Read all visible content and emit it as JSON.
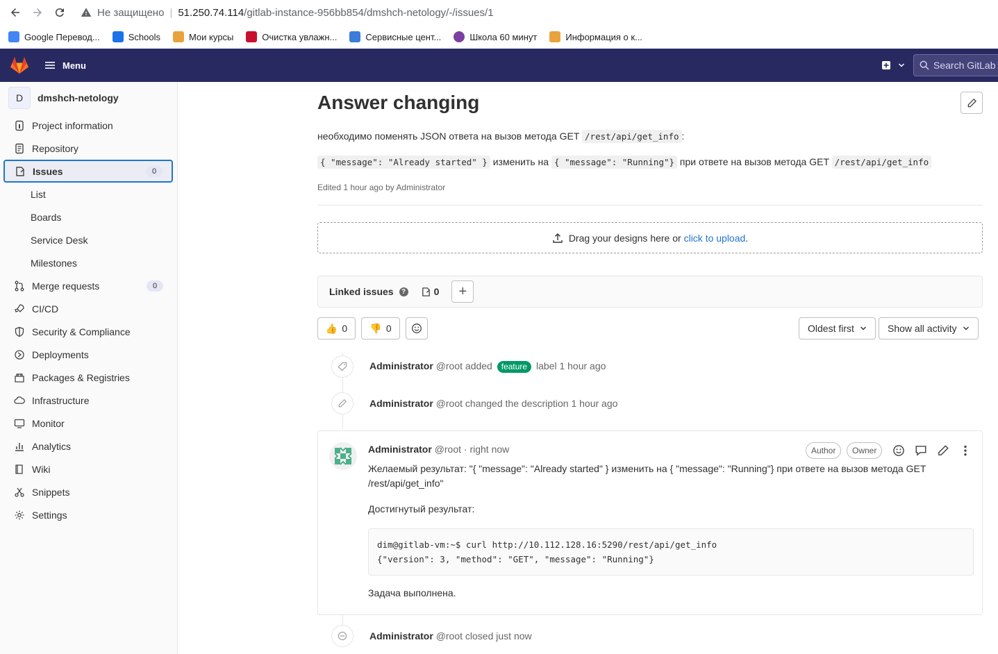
{
  "browser": {
    "insecure_label": "Не защищено",
    "url_host": "51.250.74.114",
    "url_path": "/gitlab-instance-956bb854/dmshch-netology/-/issues/1"
  },
  "bookmarks": [
    {
      "label": "Google Перевод...",
      "color": "#4285f4"
    },
    {
      "label": "Schools",
      "color": "#1a73e8"
    },
    {
      "label": "Мои курсы",
      "color": "#e8a33c"
    },
    {
      "label": "Очистка увлажн...",
      "color": "#c8102e"
    },
    {
      "label": "Сервисные цент...",
      "color": "#3b7dd8"
    },
    {
      "label": "Школа 60 минут",
      "color": "#7b3fa0"
    },
    {
      "label": "Информация о к...",
      "color": "#e8a33c"
    }
  ],
  "header": {
    "menu_label": "Menu",
    "search_placeholder": "Search GitLab",
    "bg_color": "#292961"
  },
  "sidebar": {
    "project_initial": "D",
    "project_name": "dmshch-netology",
    "items": [
      {
        "label": "Project information",
        "icon": "info-icon"
      },
      {
        "label": "Repository",
        "icon": "doc-icon"
      },
      {
        "label": "Issues",
        "icon": "issues-icon",
        "badge": "0",
        "active": true
      },
      {
        "label": "List"
      },
      {
        "label": "Boards"
      },
      {
        "label": "Service Desk"
      },
      {
        "label": "Milestones"
      },
      {
        "label": "Merge requests",
        "icon": "merge-icon",
        "badge": "0"
      },
      {
        "label": "CI/CD",
        "icon": "rocket-icon"
      },
      {
        "label": "Security & Compliance",
        "icon": "shield-icon"
      },
      {
        "label": "Deployments",
        "icon": "deploy-icon"
      },
      {
        "label": "Packages & Registries",
        "icon": "package-icon"
      },
      {
        "label": "Infrastructure",
        "icon": "cloud-icon"
      },
      {
        "label": "Monitor",
        "icon": "monitor-icon"
      },
      {
        "label": "Analytics",
        "icon": "chart-icon"
      },
      {
        "label": "Wiki",
        "icon": "book-icon"
      },
      {
        "label": "Snippets",
        "icon": "scissors-icon"
      },
      {
        "label": "Settings",
        "icon": "gear-icon"
      }
    ]
  },
  "issue": {
    "title": "Answer changing",
    "desc_line1_text": "необходимо поменять JSON ответа на вызов метода GET",
    "desc_line1_code": "/rest/api/get_info",
    "desc_line1_end": ":",
    "desc_line2_code1": "{ \"message\": \"Already started\" }",
    "desc_line2_mid": "изменить на",
    "desc_line2_code2": "{ \"message\": \"Running\"}",
    "desc_line2_text": "при ответе на вызов метода GET",
    "desc_line2_code3": "/rest/api/get_info",
    "edited": "Edited 1 hour ago by Administrator"
  },
  "dropzone": {
    "text": "Drag your designs here or",
    "link": "click to upload",
    "end": "."
  },
  "linked": {
    "label": "Linked issues",
    "count": "0"
  },
  "reactions": {
    "thumbsup": "0",
    "thumbsdown": "0",
    "sort_label": "Oldest first",
    "filter_label": "Show all activity"
  },
  "notes": {
    "n1_author": "Administrator",
    "n1_text_before": "@root added",
    "n1_label": "feature",
    "n1_text_after": "label 1 hour ago",
    "n2_author": "Administrator",
    "n2_text": "@root changed the description 1 hour ago",
    "n3_author": "Administrator",
    "n3_text": "@root closed just now"
  },
  "comment": {
    "author": "Administrator",
    "meta": "@root · right now",
    "role_author": "Author",
    "role_owner": "Owner",
    "line1": "Желаемый результат: \"{ \"message\": \"Already started\" } изменить на { \"message\": \"Running\"} при ответе на вызов метода GET",
    "line2": "/rest/api/get_info\"",
    "achieved": "Достигнутый результат:",
    "code": "dim@gitlab-vm:~$ curl http://10.112.128.16:5290/rest/api/get_info\n{\"version\": 3, \"method\": \"GET\", \"message\": \"Running\"}",
    "done": "Задача выполнена."
  }
}
